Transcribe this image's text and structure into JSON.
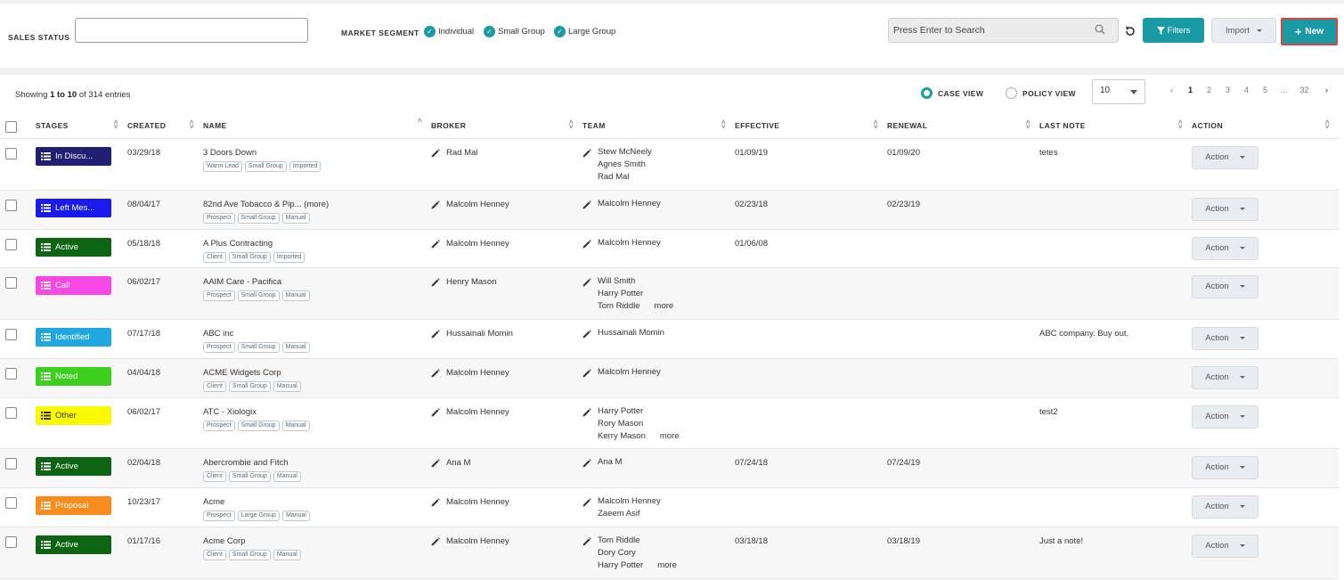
{
  "filters": {
    "sales_status_label": "SALES STATUS",
    "sales_status_value": "",
    "market_segment_label": "MARKET SEGMENT",
    "segments": [
      "Individual",
      "Small Group",
      "Large Group"
    ],
    "search_placeholder": "Press Enter to Search",
    "filters_label": "Filters",
    "import_label": "Import",
    "new_label": "New"
  },
  "list": {
    "showing_prefix": "Showing ",
    "showing_range": "1 to 10",
    "showing_suffix": " of 314 entries",
    "case_view_label": "CASE VIEW",
    "policy_view_label": "POLICY VIEW",
    "page_size": "10",
    "pages": [
      "‹",
      "1",
      "2",
      "3",
      "4",
      "5",
      "...",
      "32",
      "›"
    ],
    "current_page": "1"
  },
  "columns": [
    "STAGES",
    "CREATED",
    "NAME",
    "BROKER",
    "TEAM",
    "EFFECTIVE",
    "RENEWAL",
    "LAST NOTE",
    "ACTION"
  ],
  "rows": [
    {
      "stage": "In Discu...",
      "stage_color": "#1f1f73",
      "created": "03/29/18",
      "name": "3 Doors Down",
      "tags": [
        "Warm Lead",
        "Small Group",
        "Imported"
      ],
      "broker": "Rad Mal",
      "team": [
        "Stew McNeely",
        "Agnes Smith",
        "Rad Mal"
      ],
      "team_more": "",
      "effective": "01/09/19",
      "renewal": "01/09/20",
      "note": "tetes",
      "action": "Action"
    },
    {
      "stage": "Left Mes...",
      "stage_color": "#1a1aee",
      "created": "08/04/17",
      "name": "82nd Ave Tobacco & Pip... (more)",
      "tags": [
        "Prospect",
        "Small Group",
        "Manual"
      ],
      "broker": "Malcolm Henney",
      "team": [
        "Malcolm Henney"
      ],
      "team_more": "",
      "effective": "02/23/18",
      "renewal": "02/23/19",
      "note": "",
      "action": "Action"
    },
    {
      "stage": "Active",
      "stage_color": "#0d6412",
      "created": "05/18/18",
      "name": "A Plus Contracting",
      "tags": [
        "Client",
        "Small Group",
        "Imported"
      ],
      "broker": "Malcolm Henney",
      "team": [
        "Malcolm Henney"
      ],
      "team_more": "",
      "effective": "01/06/08",
      "renewal": "",
      "note": "",
      "action": "Action"
    },
    {
      "stage": "Call",
      "stage_color": "#f548e4",
      "created": "06/02/17",
      "name": "AAIM Care - Pacifica",
      "tags": [
        "Prospect",
        "Small Group",
        "Manual"
      ],
      "broker": "Henry Mason",
      "team": [
        "Will Smith",
        "Harry Potter",
        "Tom Riddle"
      ],
      "team_more": "more",
      "effective": "",
      "renewal": "",
      "note": "",
      "action": "Action"
    },
    {
      "stage": "Identified",
      "stage_color": "#1fa8e0",
      "created": "07/17/18",
      "name": "ABC inc",
      "tags": [
        "Prospect",
        "Small Group",
        "Manual"
      ],
      "broker": "Hussainali Momin",
      "team": [
        "Hussainali Momin"
      ],
      "team_more": "",
      "effective": "",
      "renewal": "",
      "note": "ABC company. Buy out.",
      "action": "Action"
    },
    {
      "stage": "Noted",
      "stage_color": "#3ccf1e",
      "created": "04/04/18",
      "name": "ACME Widgets Corp",
      "tags": [
        "Client",
        "Small Group",
        "Manual"
      ],
      "broker": "Malcolm Henney",
      "team": [
        "Malcolm Henney"
      ],
      "team_more": "",
      "effective": "",
      "renewal": "",
      "note": "",
      "action": "Action"
    },
    {
      "stage": "Other",
      "stage_color": "#fafa00",
      "created": "06/02/17",
      "name": "ATC - Xiologix",
      "tags": [
        "Prospect",
        "Small Group",
        "Manual"
      ],
      "broker": "Malcolm Henney",
      "team": [
        "Harry Potter",
        "Rory Mason",
        "Kerry Mason"
      ],
      "team_more": "more",
      "effective": "",
      "renewal": "",
      "note": "test2",
      "action": "Action"
    },
    {
      "stage": "Active",
      "stage_color": "#0d6412",
      "created": "02/04/18",
      "name": "Abercrombie and Fitch",
      "tags": [
        "Client",
        "Small Group",
        "Manual"
      ],
      "broker": "Ana M",
      "team": [
        "Ana M"
      ],
      "team_more": "",
      "effective": "07/24/18",
      "renewal": "07/24/19",
      "note": "",
      "action": "Action"
    },
    {
      "stage": "Proposal",
      "stage_color": "#fa8c1e",
      "created": "10/23/17",
      "name": "Acme",
      "tags": [
        "Prospect",
        "Large Group",
        "Manual"
      ],
      "broker": "Malcolm Henney",
      "team": [
        "Malcolm Henney",
        "Zaeem Asif"
      ],
      "team_more": "",
      "effective": "",
      "renewal": "",
      "note": "",
      "action": "Action"
    },
    {
      "stage": "Active",
      "stage_color": "#0d6412",
      "created": "01/17/16",
      "name": "Acme Corp",
      "tags": [
        "Client",
        "Small Group",
        "Manual"
      ],
      "broker": "Malcolm Henney",
      "team": [
        "Tom Riddle",
        "Dory Cory",
        "Harry Potter"
      ],
      "team_more": "more",
      "effective": "03/18/18",
      "renewal": "03/18/19",
      "note": "Just a note!",
      "action": "Action"
    }
  ]
}
